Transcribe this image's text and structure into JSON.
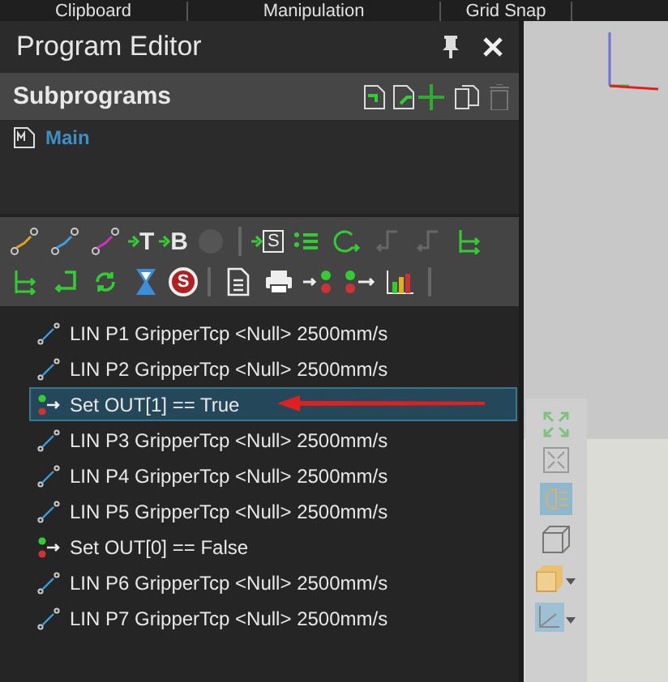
{
  "ribbon_groups": [
    "Clipboard",
    "Manipulation",
    "Grid Snap"
  ],
  "panel": {
    "title": "Program Editor"
  },
  "subprograms": {
    "title": "Subprograms",
    "items": [
      {
        "label": "Main",
        "selected": true
      }
    ]
  },
  "toolbar": [
    [
      {
        "kind": "path-orange",
        "disabled": false
      },
      {
        "kind": "path-blue",
        "disabled": false
      },
      {
        "kind": "path-magenta",
        "disabled": false
      },
      {
        "kind": "arrow-letter",
        "label": "T",
        "disabled": false
      },
      {
        "kind": "arrow-letter",
        "label": "B",
        "disabled": false
      },
      {
        "kind": "circle",
        "disabled": true
      },
      {
        "kind": "sep"
      },
      {
        "kind": "doc-letter",
        "label": "S",
        "disabled": false
      },
      {
        "kind": "list",
        "disabled": false
      },
      {
        "kind": "loop",
        "disabled": false
      },
      {
        "kind": "branch-left",
        "disabled": true
      },
      {
        "kind": "branch-right",
        "disabled": true
      },
      {
        "kind": "fork",
        "disabled": false
      }
    ],
    [
      {
        "kind": "fork",
        "disabled": false
      },
      {
        "kind": "return",
        "disabled": false
      },
      {
        "kind": "refresh",
        "disabled": false
      },
      {
        "kind": "hourglass",
        "disabled": false
      },
      {
        "kind": "stop",
        "label": "S",
        "disabled": false
      },
      {
        "kind": "sep"
      },
      {
        "kind": "document",
        "disabled": false
      },
      {
        "kind": "printer",
        "disabled": false
      },
      {
        "kind": "signal-in",
        "disabled": false
      },
      {
        "kind": "signal-out",
        "disabled": false
      },
      {
        "kind": "chart",
        "disabled": false
      },
      {
        "kind": "sep"
      }
    ]
  ],
  "program": [
    {
      "kind": "lin",
      "text": "LIN P1 GripperTcp <Null> 2500mm/s",
      "selected": false,
      "marked": false
    },
    {
      "kind": "lin",
      "text": "LIN P2 GripperTcp <Null> 2500mm/s",
      "selected": false,
      "marked": false
    },
    {
      "kind": "set",
      "text": "Set OUT[1] == True",
      "selected": true,
      "marked": true
    },
    {
      "kind": "lin",
      "text": "LIN P3 GripperTcp <Null> 2500mm/s",
      "selected": false,
      "marked": false
    },
    {
      "kind": "lin",
      "text": "LIN P4 GripperTcp <Null> 2500mm/s",
      "selected": false,
      "marked": false
    },
    {
      "kind": "lin",
      "text": "LIN P5 GripperTcp <Null> 2500mm/s",
      "selected": false,
      "marked": false
    },
    {
      "kind": "set",
      "text": "Set OUT[0] == False",
      "selected": false,
      "marked": false
    },
    {
      "kind": "lin",
      "text": "LIN P6 GripperTcp <Null> 2500mm/s",
      "selected": false,
      "marked": false
    },
    {
      "kind": "lin",
      "text": "LIN P7 GripperTcp <Null> 2500mm/s",
      "selected": false,
      "marked": false
    }
  ]
}
